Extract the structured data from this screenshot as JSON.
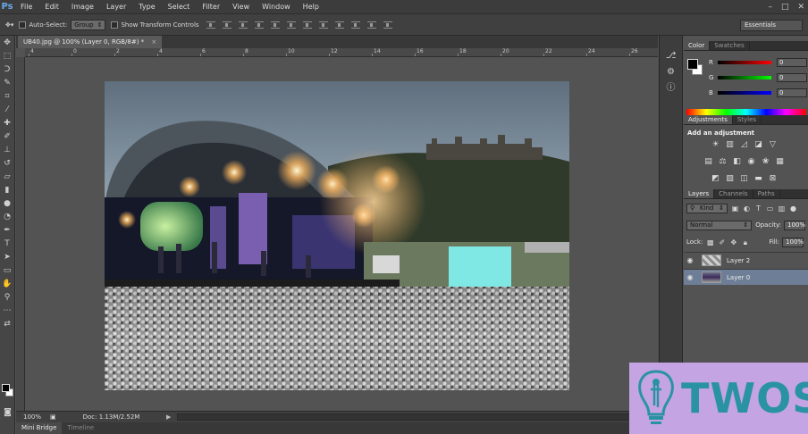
{
  "menubar": {
    "items": [
      "File",
      "Edit",
      "Image",
      "Layer",
      "Type",
      "Select",
      "Filter",
      "View",
      "Window",
      "Help"
    ]
  },
  "options_bar": {
    "auto_select_label": "Auto-Select:",
    "auto_select_value": "Group",
    "show_transform_label": "Show Transform Controls",
    "workspace": "Essentials"
  },
  "document": {
    "tab_title": "UB40.jpg @ 100% (Layer 0, RGB/8#) *",
    "ruler_marks": [
      "4",
      "0",
      "2",
      "4",
      "6",
      "8",
      "10",
      "12",
      "14",
      "16",
      "18",
      "20",
      "22",
      "24",
      "26"
    ]
  },
  "status": {
    "zoom": "100%",
    "doc_info": "Doc: 1.13M/2.52M"
  },
  "bottom_tabs": [
    "Mini Bridge",
    "Timeline"
  ],
  "color_panel": {
    "tabs": [
      "Color",
      "Swatches"
    ],
    "r_label": "R",
    "g_label": "G",
    "b_label": "B",
    "r_value": "0",
    "g_value": "0",
    "b_value": "0"
  },
  "adjustments_panel": {
    "tabs": [
      "Adjustments",
      "Styles"
    ],
    "title": "Add an adjustment"
  },
  "layers_panel": {
    "tabs": [
      "Layers",
      "Channels",
      "Paths"
    ],
    "kind_label": "Kind",
    "blend_mode": "Normal",
    "opacity_label": "Opacity:",
    "opacity_value": "100%",
    "lock_label": "Lock:",
    "fill_label": "Fill:",
    "fill_value": "100%",
    "layers": [
      {
        "name": "Layer 2",
        "selected": false
      },
      {
        "name": "Layer 0",
        "selected": true
      }
    ]
  },
  "watermark": {
    "text": "TWOS"
  },
  "colors": {
    "accent_selected_layer": "#6e7e96",
    "watermark_bg": "#c4a4e3",
    "watermark_text": "#2a93a3"
  }
}
